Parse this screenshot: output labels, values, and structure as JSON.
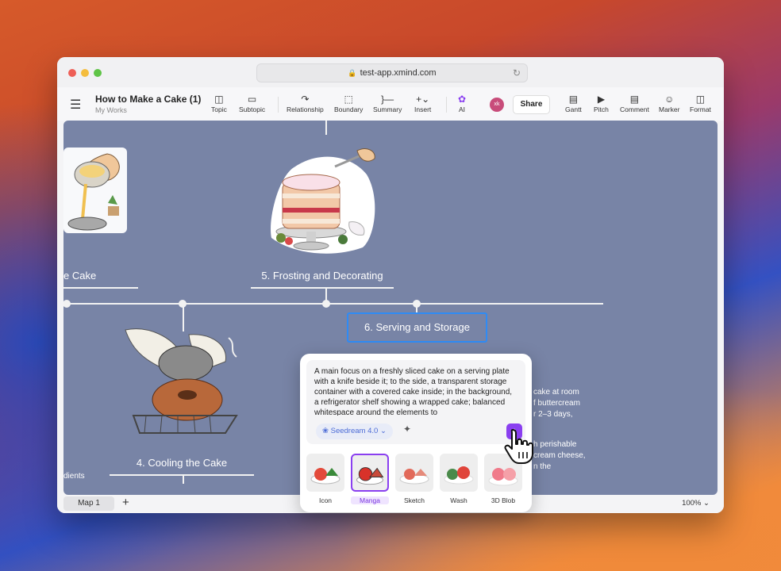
{
  "window": {
    "url": "test-app.xmind.com",
    "colors": {
      "close": "#ee5f57",
      "minimize": "#f4bd3e",
      "zoom": "#5fc447"
    }
  },
  "toolbar": {
    "doc_title": "How to Make a Cake (1)",
    "doc_subtitle": "My Works",
    "tools_left": [
      {
        "label": "Topic",
        "icon": "topic-icon"
      },
      {
        "label": "Subtopic",
        "icon": "subtopic-icon"
      },
      {
        "label": "Relationship",
        "icon": "relationship-icon"
      },
      {
        "label": "Boundary",
        "icon": "boundary-icon"
      },
      {
        "label": "Summary",
        "icon": "summary-icon"
      },
      {
        "label": "Insert",
        "icon": "insert-icon"
      },
      {
        "label": "AI",
        "icon": "ai-icon"
      }
    ],
    "avatar_initials": "xk",
    "share_label": "Share",
    "tools_right": [
      {
        "label": "Gantt",
        "icon": "gantt-icon"
      },
      {
        "label": "Pitch",
        "icon": "pitch-icon"
      },
      {
        "label": "Comment",
        "icon": "comment-icon"
      },
      {
        "label": "Marker",
        "icon": "marker-icon"
      },
      {
        "label": "Format",
        "icon": "format-icon"
      }
    ]
  },
  "canvas": {
    "background": "#7884a6",
    "topics": {
      "cake_partial": "e Cake",
      "frosting": "5. Frosting and Decorating",
      "serving": "6. Serving and Storage",
      "cooling": "4. Cooling the Cake",
      "ingredients_partial": "dients"
    },
    "background_text": [
      "cake at room",
      "f buttercream",
      "r 2–3 days,",
      "h perishable",
      "cream cheese,",
      "n the"
    ]
  },
  "ai_panel": {
    "prompt": "A main focus on a freshly sliced cake on a serving plate with a knife beside it; to the side, a transparent storage container with a covered cake inside; in the background, a refrigerator shelf showing a wrapped cake; balanced whitespace around the elements to",
    "model": "Seedream 4.0",
    "styles": [
      {
        "label": "Icon",
        "selected": false
      },
      {
        "label": "Manga",
        "selected": true
      },
      {
        "label": "Sketch",
        "selected": false
      },
      {
        "label": "Wash",
        "selected": false
      },
      {
        "label": "3D Blob",
        "selected": false
      }
    ]
  },
  "statusbar": {
    "map_tab": "Map 1",
    "add_label": "+",
    "zoom": "100%"
  }
}
